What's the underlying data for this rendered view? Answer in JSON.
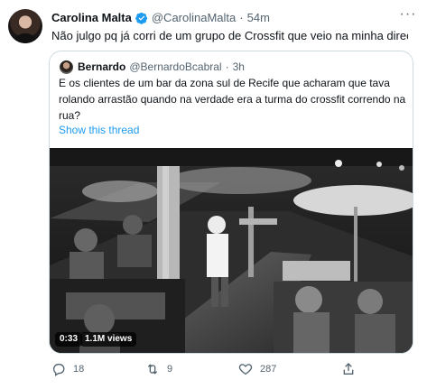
{
  "tweet": {
    "author": {
      "name": "Carolina Malta",
      "handle": "@CarolinaMalta",
      "separator": "·",
      "time": "54m"
    },
    "text": "Não julgo pq já corri de um grupo de Crossfit que veio na minha direção",
    "more_label": "···"
  },
  "quote": {
    "author": {
      "name": "Bernardo",
      "handle": "@BernardoBcabral",
      "separator": "·",
      "time": "3h"
    },
    "text": "E os clientes de um bar da zona sul de Recife que acharam que tava rolando arrastão quando na verdade era a turma do crossfit correndo na rua?",
    "show_thread": "Show this thread",
    "video": {
      "duration": "0:33",
      "views": "1.1M views"
    }
  },
  "actions": {
    "reply_count": "18",
    "retweet_count": "9",
    "like_count": "287"
  },
  "colors": {
    "text": "#0f1419",
    "secondary": "#536471",
    "link": "#1d9bf0",
    "border": "#cfd9de"
  },
  "icons": {
    "verified": "verified-badge-icon",
    "reply": "reply-icon",
    "retweet": "retweet-icon",
    "like": "heart-icon",
    "share": "share-icon"
  }
}
